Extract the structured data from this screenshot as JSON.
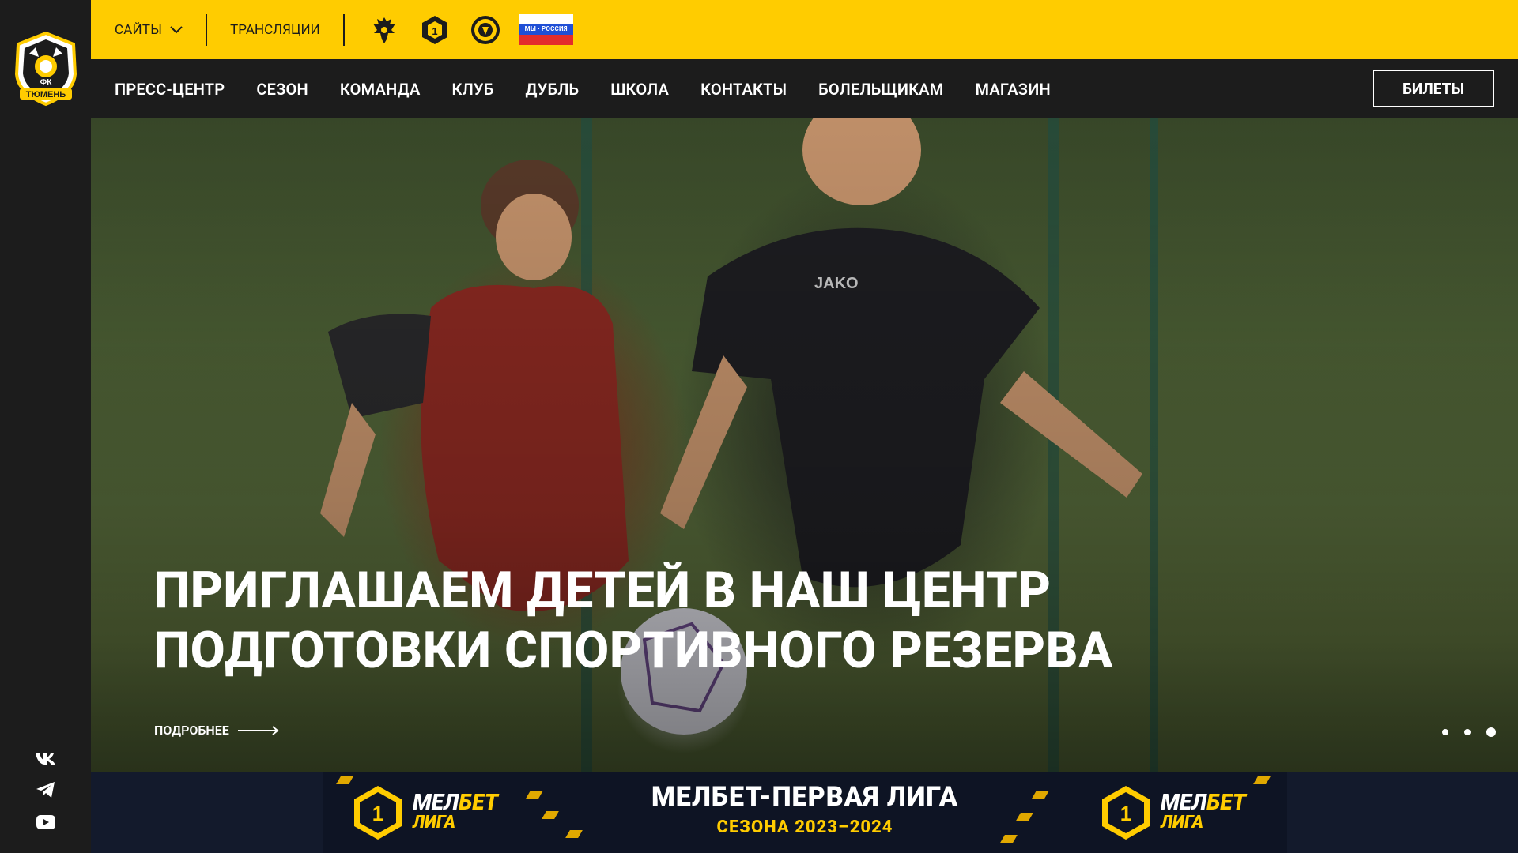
{
  "sidebar": {
    "logo": {
      "top_text": "ФК",
      "bottom_text": "ТЮМЕНЬ"
    },
    "social": [
      {
        "name": "vk-icon",
        "glyph": "VK"
      },
      {
        "name": "telegram-icon",
        "glyph": "✈"
      },
      {
        "name": "youtube-icon",
        "glyph": "▶"
      }
    ]
  },
  "topbar": {
    "sites_label": "САЙТЫ",
    "broadcasts_label": "ТРАНСЛЯЦИИ",
    "icons": [
      "rfs-eagle-icon",
      "first-league-icon",
      "club-badge-icon",
      "russia-flag-icon"
    ],
    "flag_text": "МЫ · РОССИЯ",
    "accent_color": "#ffcc00"
  },
  "nav": {
    "items": [
      "ПРЕСС-ЦЕНТР",
      "СЕЗОН",
      "КОМАНДА",
      "КЛУБ",
      "ДУБЛЬ",
      "ШКОЛА",
      "КОНТАКТЫ",
      "БОЛЕЛЬЩИКАМ",
      "МАГАЗИН"
    ],
    "tickets_label": "БИЛЕТЫ"
  },
  "hero": {
    "headline_line1": "ПРИГЛАШАЕМ ДЕТЕЙ В НАШ ЦЕНТР",
    "headline_line2": "ПОДГОТОВКИ СПОРТИВНОГО РЕЗЕРВА",
    "more_label": "ПОДРОБНЕЕ",
    "slides_count": 3,
    "active_slide": 3,
    "jersey_text": "JAKO"
  },
  "banner": {
    "title": "МЕЛБЕТ-ПЕРВАЯ ЛИГА",
    "subtitle": "СЕЗОНА 2023–2024",
    "logo_word1": "МЕЛ",
    "logo_word1_accent": "БЕТ",
    "logo_word2": "ЛИГА",
    "logo_number": "1"
  }
}
